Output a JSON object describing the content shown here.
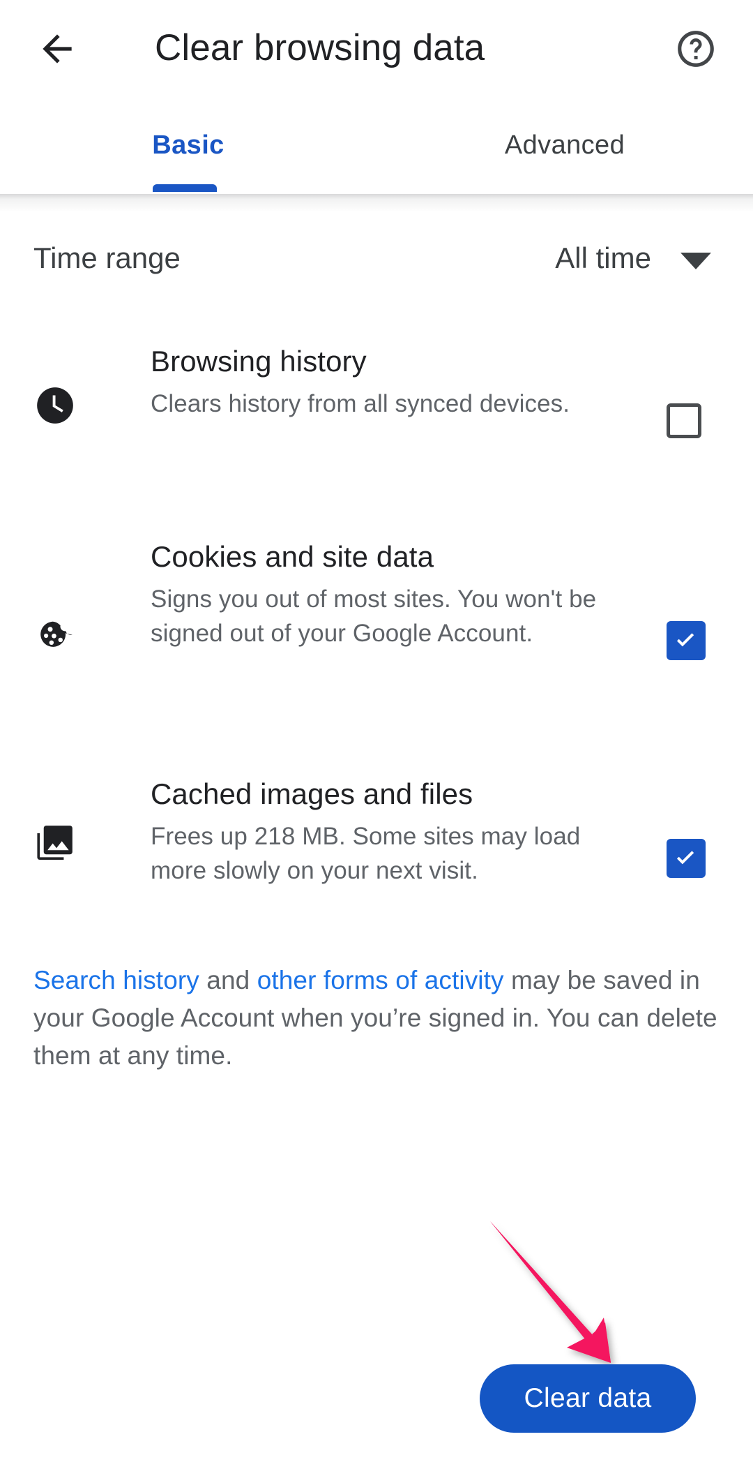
{
  "appbar": {
    "back_icon": "arrow-back-icon",
    "title": "Clear browsing data",
    "help_icon": "help-circle-icon"
  },
  "tabs": [
    {
      "label": "Basic",
      "selected": true
    },
    {
      "label": "Advanced",
      "selected": false
    }
  ],
  "time_range": {
    "label": "Time range",
    "value": "All time",
    "caret_icon": "chevron-down-icon"
  },
  "options": [
    {
      "icon": "clock-icon",
      "title": "Browsing history",
      "description": "Clears history from all synced devices.",
      "checked": false
    },
    {
      "icon": "cookie-icon",
      "title": "Cookies and site data",
      "description": "Signs you out of most sites. You won't be signed out of your Google Account.",
      "checked": true
    },
    {
      "icon": "photo-library-icon",
      "title": "Cached images and files",
      "description": "Frees up 218 MB. Some sites may load more slowly on your next visit.",
      "checked": true
    }
  ],
  "footnote": {
    "link1": "Search history",
    "mid": " and ",
    "link2": "other forms of activity",
    "tail": " may be saved in your Google Account when you’re signed in. You can delete them at any time."
  },
  "clear_button": {
    "label": "Clear data"
  },
  "annotation": {
    "arrow_icon": "pointer-arrow-icon",
    "color": "#f4155e"
  },
  "colors": {
    "accent_blue": "#1a56c4",
    "link_blue": "#1a73e8",
    "text_primary": "#202124",
    "text_secondary": "#5f6368",
    "annotation_pink": "#f4155e"
  }
}
